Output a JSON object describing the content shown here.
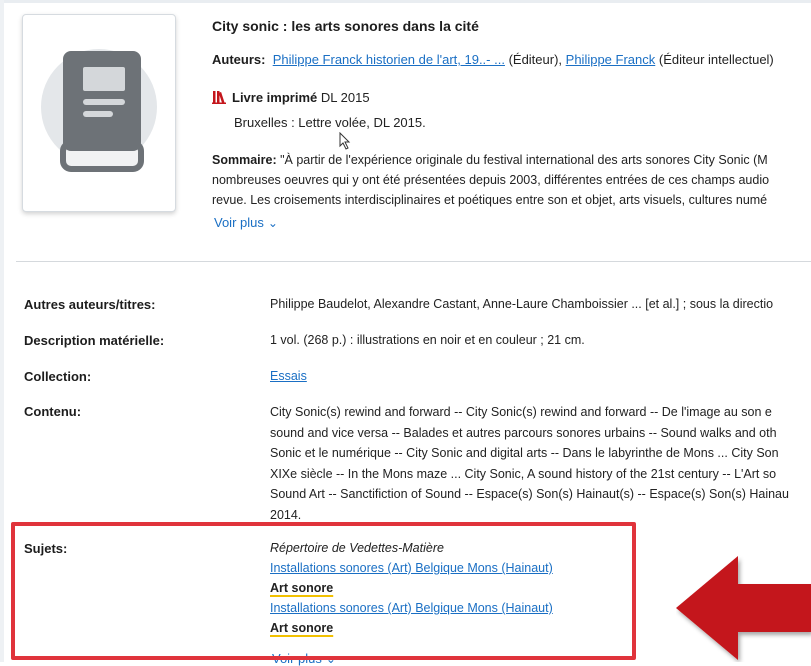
{
  "record": {
    "title": "City sonic : les arts sonores dans la cité",
    "authors_label": "Auteurs:",
    "author1": "Philippe Franck historien de l'art, 19..- ...",
    "author1_role": " (Éditeur),",
    "author2": "Philippe Franck",
    "author2_role": " (Éditeur intellectuel)",
    "type": "Livre imprimé",
    "type_date": " DL 2015",
    "publisher": "Bruxelles : Lettre volée, DL 2015.",
    "summary_label": "Sommaire:",
    "summary_lines": [
      " \"À partir de l'expérience originale du festival international des arts sonores City Sonic (M",
      "nombreuses oeuvres qui y ont été présentées depuis 2003, différentes entrées de ces champs audio",
      "revue. Les croisements interdisciplinaires et poétiques entre son et objet, arts visuels, cultures numé"
    ],
    "voir_plus": "Voir plus"
  },
  "details": {
    "autres_label": "Autres auteurs/titres:",
    "autres_value": "Philippe Baudelot, Alexandre Castant, Anne-Laure Chamboissier ... [et al.] ; sous la directio",
    "desc_label": "Description matérielle:",
    "desc_value": "1 vol. (268 p.) : illustrations en noir et en couleur ; 21 cm.",
    "collection_label": "Collection:",
    "collection_value": "Essais",
    "contenu_label": "Contenu:",
    "contenu_lines": [
      "City Sonic(s) rewind and forward -- City Sonic(s) rewind and forward -- De l'image au son e",
      "sound and vice versa -- Balades et autres parcours sonores urbains -- Sound walks and oth",
      "Sonic et le numérique -- City Sonic and digital arts -- Dans le labyrinthe de Mons ... City Son",
      "XIXe siècle -- In the Mons maze ... City Sonic, A sound history of the 21st century -- L'Art so",
      "Sound Art -- Sanctifiction of Sound -- Espace(s) Son(s) Hainaut(s) -- Espace(s) Son(s) Hainau",
      "2014."
    ],
    "sujets_label": "Sujets:",
    "sujets_head": "Répertoire de Vedettes-Matière",
    "sujet1": "Installations sonores (Art) Belgique Mons (Hainaut)",
    "sujet2": "Art sonore",
    "sujet3": "Installations sonores (Art) Belgique Mons (Hainaut)",
    "sujet4": "Art sonore",
    "voir_plus": "Voir plus"
  },
  "colors": {
    "link": "#1a6fc4",
    "highlight_border": "#e0333b",
    "arrow": "#c4161c",
    "underline_accent": "#f2c100"
  }
}
